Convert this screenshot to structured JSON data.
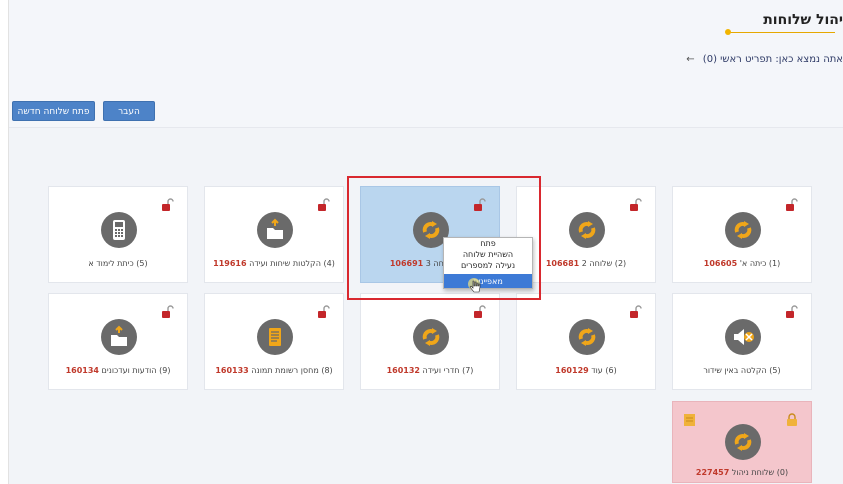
{
  "header": {
    "title": "יהול שלוחות",
    "breadcrumb_prefix": "אתה נמצא כאן:",
    "breadcrumb_current": "תפריט ראשי (0)",
    "breadcrumb_arrow": "←"
  },
  "toolbar": {
    "new_label": "פתח שלוחה חדשה",
    "move_label": "העבר"
  },
  "tiles": [
    {
      "label": "(1) כיתה א'",
      "num": "106605"
    },
    {
      "label": "(2) שלוחה 2",
      "num": "106681"
    },
    {
      "label": "(3) שלוחה 3",
      "num": "106691"
    },
    {
      "label": "(4) הקלטות שיחות ועידה",
      "num": "119616"
    },
    {
      "label": "(5) כיתת לימוד א",
      "num": ""
    },
    {
      "label": "(5) הקלטה באין שידור",
      "num": ""
    },
    {
      "label": "(6) עוד",
      "num": "160129"
    },
    {
      "label": "(7) חדרי ועידה",
      "num": "160132"
    },
    {
      "label": "(8) מחסן רשומת תמונה",
      "num": "160133"
    },
    {
      "label": "(9) הודעות ועדכונים",
      "num": "160134"
    },
    {
      "label": "(0) שלוחת ניהול",
      "num": "227457"
    }
  ],
  "context_menu": {
    "items": [
      "פתח",
      "השהיית שלוחה",
      "נעילה למספרים"
    ],
    "active": "מאפיינים"
  },
  "colors": {
    "accent": "#4d83c8",
    "highlight": "#d9282f",
    "selected_tile": "#bad6ef",
    "root_tile": "#f4c6cc",
    "number": "#c0392b"
  }
}
